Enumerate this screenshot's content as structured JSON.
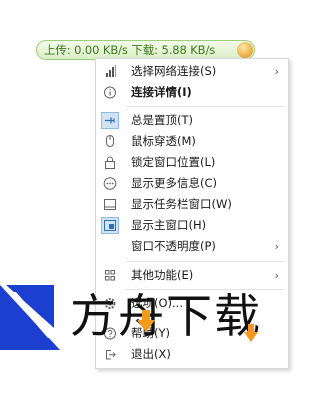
{
  "speed_widget": {
    "text": "上传: 0.00 KB/s   下载: 5.88 KB/s"
  },
  "menu": {
    "items": [
      {
        "label": "选择网络连接(S)",
        "icon": "signal-bars-icon",
        "submenu": true
      },
      {
        "label": "连接详情(I)",
        "icon": "info-icon",
        "submenu": false
      },
      {
        "label": "总是置顶(T)",
        "icon": "pin-icon",
        "submenu": false
      },
      {
        "label": "鼠标穿透(M)",
        "icon": "mouse-icon",
        "submenu": false
      },
      {
        "label": "锁定窗口位置(L)",
        "icon": "lock-icon",
        "submenu": false
      },
      {
        "label": "显示更多信息(C)",
        "icon": "more-icon",
        "submenu": false
      },
      {
        "label": "显示任务栏窗口(W)",
        "icon": "taskbar-icon",
        "submenu": false
      },
      {
        "label": "显示主窗口(H)",
        "icon": "main-window-icon",
        "submenu": false
      },
      {
        "label": "窗口不透明度(P)",
        "icon": "",
        "submenu": true
      },
      {
        "label": "其他功能(E)",
        "icon": "grid-icon",
        "submenu": true
      },
      {
        "label": "选项(O)...",
        "icon": "gear-icon",
        "submenu": false
      },
      {
        "label": "帮助(Y)",
        "icon": "help-icon",
        "submenu": false
      },
      {
        "label": "退出(X)",
        "icon": "exit-icon",
        "submenu": false
      }
    ],
    "arrow_glyph": "›"
  },
  "watermark": {
    "text": "方舟下载"
  },
  "colors": {
    "widget_text": "#3a7a1a",
    "highlight": "#cfe4f7",
    "watermark_blue": "#1d3fcf",
    "watermark_orange": "#f39a1c"
  }
}
